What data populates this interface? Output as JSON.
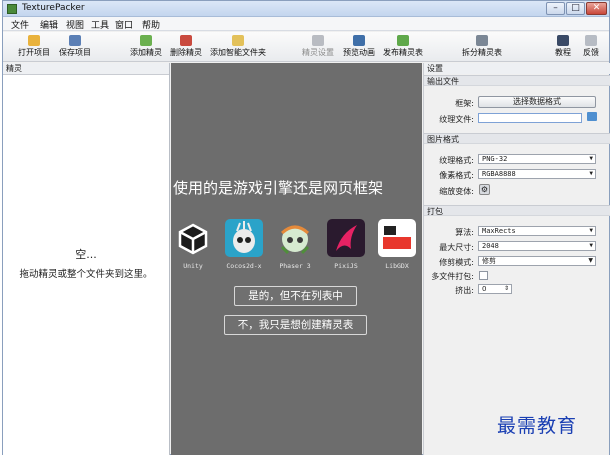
{
  "window": {
    "title": "TexturePacker"
  },
  "menu": [
    "文件",
    "编辑",
    "视图",
    "工具",
    "窗口",
    "帮助"
  ],
  "toolbar": [
    {
      "label": "打开项目",
      "icon": "folder-open-icon",
      "enabled": true
    },
    {
      "label": "保存项目",
      "icon": "save-icon",
      "enabled": true
    },
    {
      "label": "添加精灵",
      "icon": "add-sprite-icon",
      "enabled": true
    },
    {
      "label": "删除精灵",
      "icon": "delete-sprite-icon",
      "enabled": true
    },
    {
      "label": "添加智能文件夹",
      "icon": "add-smart-folder-icon",
      "enabled": true
    },
    {
      "label": "精灵设置",
      "icon": "sprite-settings-icon",
      "enabled": false
    },
    {
      "label": "预览动画",
      "icon": "preview-animation-icon",
      "enabled": true
    },
    {
      "label": "发布精灵表",
      "icon": "publish-icon",
      "enabled": true
    },
    {
      "label": "拆分精灵表",
      "icon": "split-sheet-icon",
      "enabled": true
    },
    {
      "label": "教程",
      "icon": "tutorial-icon",
      "enabled": true
    },
    {
      "label": "反馈",
      "icon": "feedback-icon",
      "enabled": true
    }
  ],
  "sprites_panel": {
    "header": "精灵",
    "empty_title": "空...",
    "empty_hint": "拖动精灵或整个文件夹到这里。"
  },
  "center": {
    "question": "使用的是游戏引擎还是网页框架",
    "engines": [
      {
        "name": "Unity",
        "color": "#111111"
      },
      {
        "name": "Cocos2d-x",
        "color": "#2aa3c9"
      },
      {
        "name": "Phaser 3",
        "color": "#7fb7d9"
      },
      {
        "name": "PixiJS",
        "color": "#e72264"
      },
      {
        "name": "LibGDX",
        "color": "#ffffff"
      }
    ],
    "answers": [
      "是的，但不在列表中",
      "不，我只是想创建精灵表"
    ]
  },
  "settings": {
    "title": "设置",
    "output": {
      "header": "输出文件",
      "framework_label": "框架:",
      "framework_button": "选择数据格式",
      "texture_file_label": "纹理文件:",
      "texture_file_value": ""
    },
    "image_format": {
      "header": "图片格式",
      "texture_format_label": "纹理格式:",
      "texture_format_value": "PNG-32",
      "pixel_format_label": "像素格式:",
      "pixel_format_value": "RGBA8888",
      "scale_label": "缩放变体:"
    },
    "packing": {
      "header": "打包",
      "algorithm_label": "算法:",
      "algorithm_value": "MaxRects",
      "max_size_label": "最大尺寸:",
      "max_size_value": "2048",
      "trim_mode_label": "修剪模式:",
      "trim_mode_value": "修剪",
      "multipack_label": "多文件打包:",
      "multipack_checked": false,
      "extrude_label": "挤出:",
      "extrude_value": "0"
    }
  },
  "watermark": "最需教育"
}
